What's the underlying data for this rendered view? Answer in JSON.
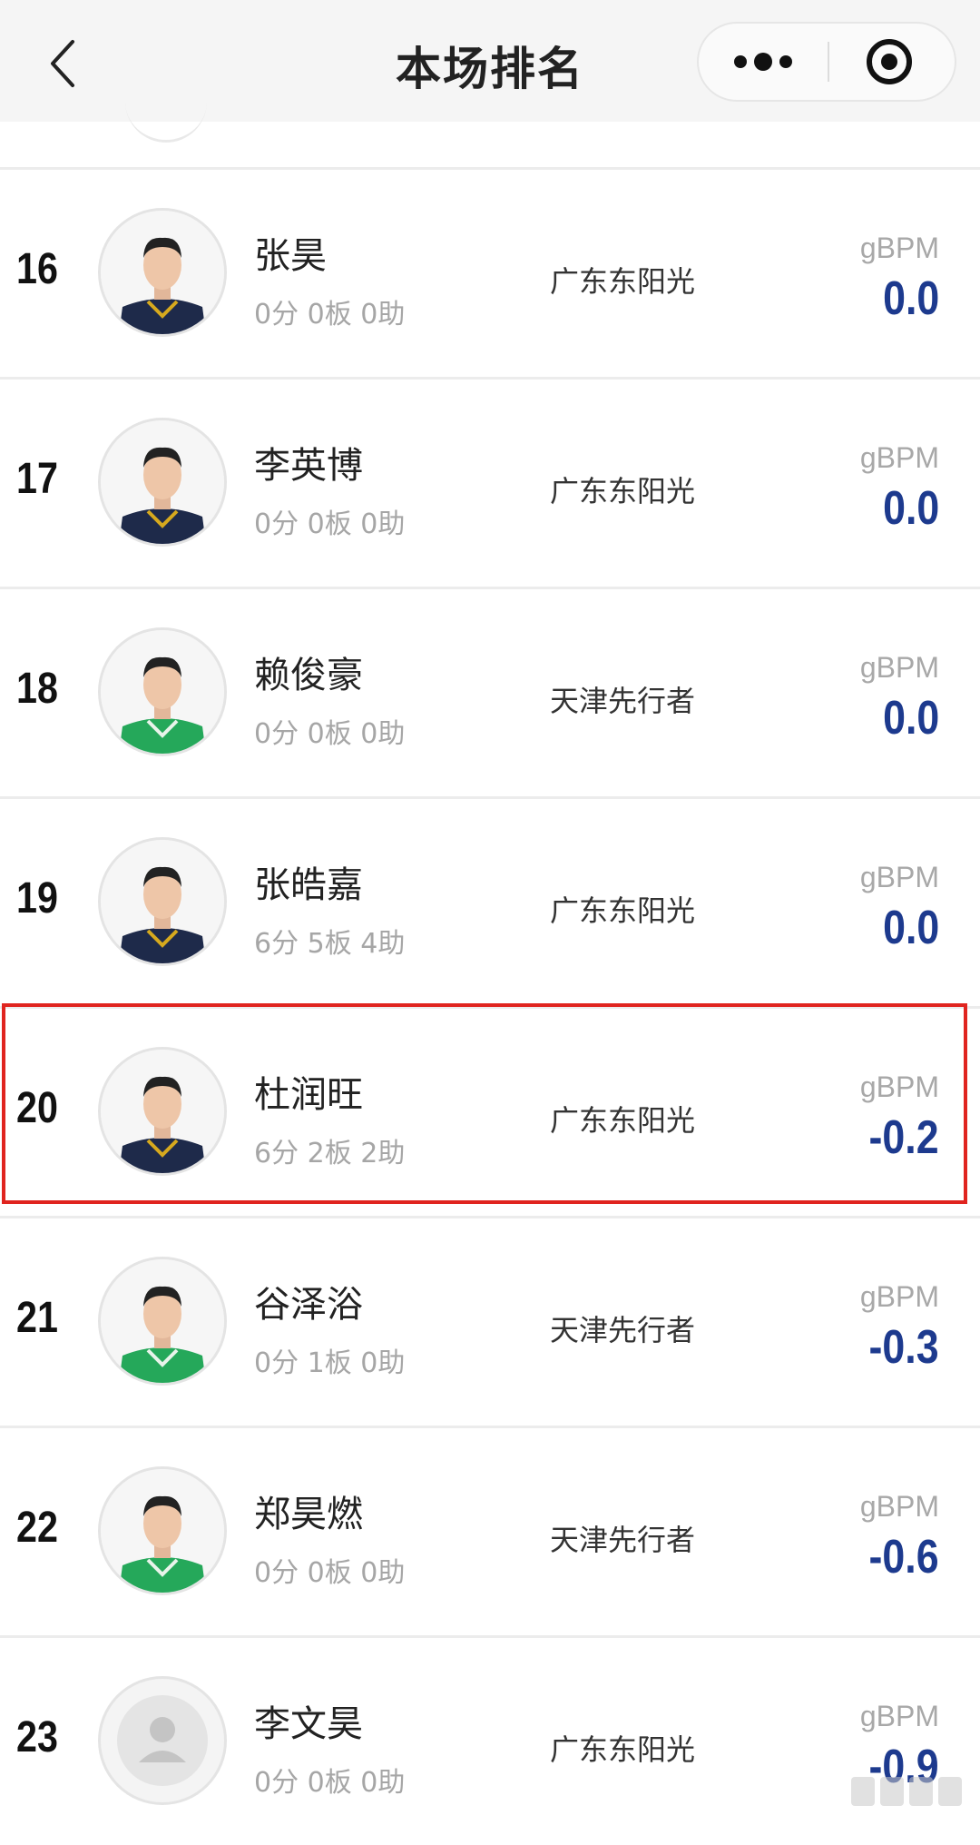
{
  "header": {
    "title": "本场排名",
    "back_icon": "chevron-left-icon",
    "more_icon": "more-dots-icon",
    "close_icon": "target-close-icon"
  },
  "colors": {
    "value_blue": "#1d3a8e",
    "highlight_red": "#e0241f",
    "stats_gray": "#a6a6a6"
  },
  "rows": [
    {
      "rank": "16",
      "name": "张昊",
      "stats": "0分 0板 0助",
      "team": "广东东阳光",
      "metric": "gBPM",
      "value": "0.0",
      "jersey": "dark"
    },
    {
      "rank": "17",
      "name": "李英博",
      "stats": "0分 0板 0助",
      "team": "广东东阳光",
      "metric": "gBPM",
      "value": "0.0",
      "jersey": "dark"
    },
    {
      "rank": "18",
      "name": "赖俊豪",
      "stats": "0分 0板 0助",
      "team": "天津先行者",
      "metric": "gBPM",
      "value": "0.0",
      "jersey": "green"
    },
    {
      "rank": "19",
      "name": "张皓嘉",
      "stats": "6分 5板 4助",
      "team": "广东东阳光",
      "metric": "gBPM",
      "value": "0.0",
      "jersey": "dark"
    },
    {
      "rank": "20",
      "name": "杜润旺",
      "stats": "6分 2板 2助",
      "team": "广东东阳光",
      "metric": "gBPM",
      "value": "-0.2",
      "jersey": "dark",
      "highlighted": true
    },
    {
      "rank": "21",
      "name": "谷泽浴",
      "stats": "0分 1板 0助",
      "team": "天津先行者",
      "metric": "gBPM",
      "value": "-0.3",
      "jersey": "green"
    },
    {
      "rank": "22",
      "name": "郑昊燃",
      "stats": "0分 0板 0助",
      "team": "天津先行者",
      "metric": "gBPM",
      "value": "-0.6",
      "jersey": "green"
    },
    {
      "rank": "23",
      "name": "李文昊",
      "stats": "0分 0板 0助",
      "team": "广东东阳光",
      "metric": "gBPM",
      "value": "-0.9",
      "jersey": "placeholder"
    }
  ]
}
